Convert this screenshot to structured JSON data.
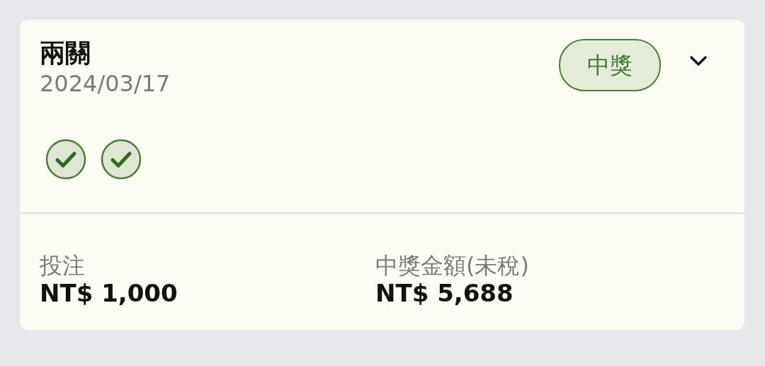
{
  "bet": {
    "title": "兩關",
    "date": "2024/03/17",
    "status": "中獎",
    "expanded": false,
    "legs": [
      {
        "won": true
      },
      {
        "won": true
      }
    ],
    "amounts": [
      {
        "label": "投注",
        "value": "NT$ 1,000"
      },
      {
        "label": "中獎金額(未稅)",
        "value": "NT$ 5,688"
      }
    ]
  }
}
